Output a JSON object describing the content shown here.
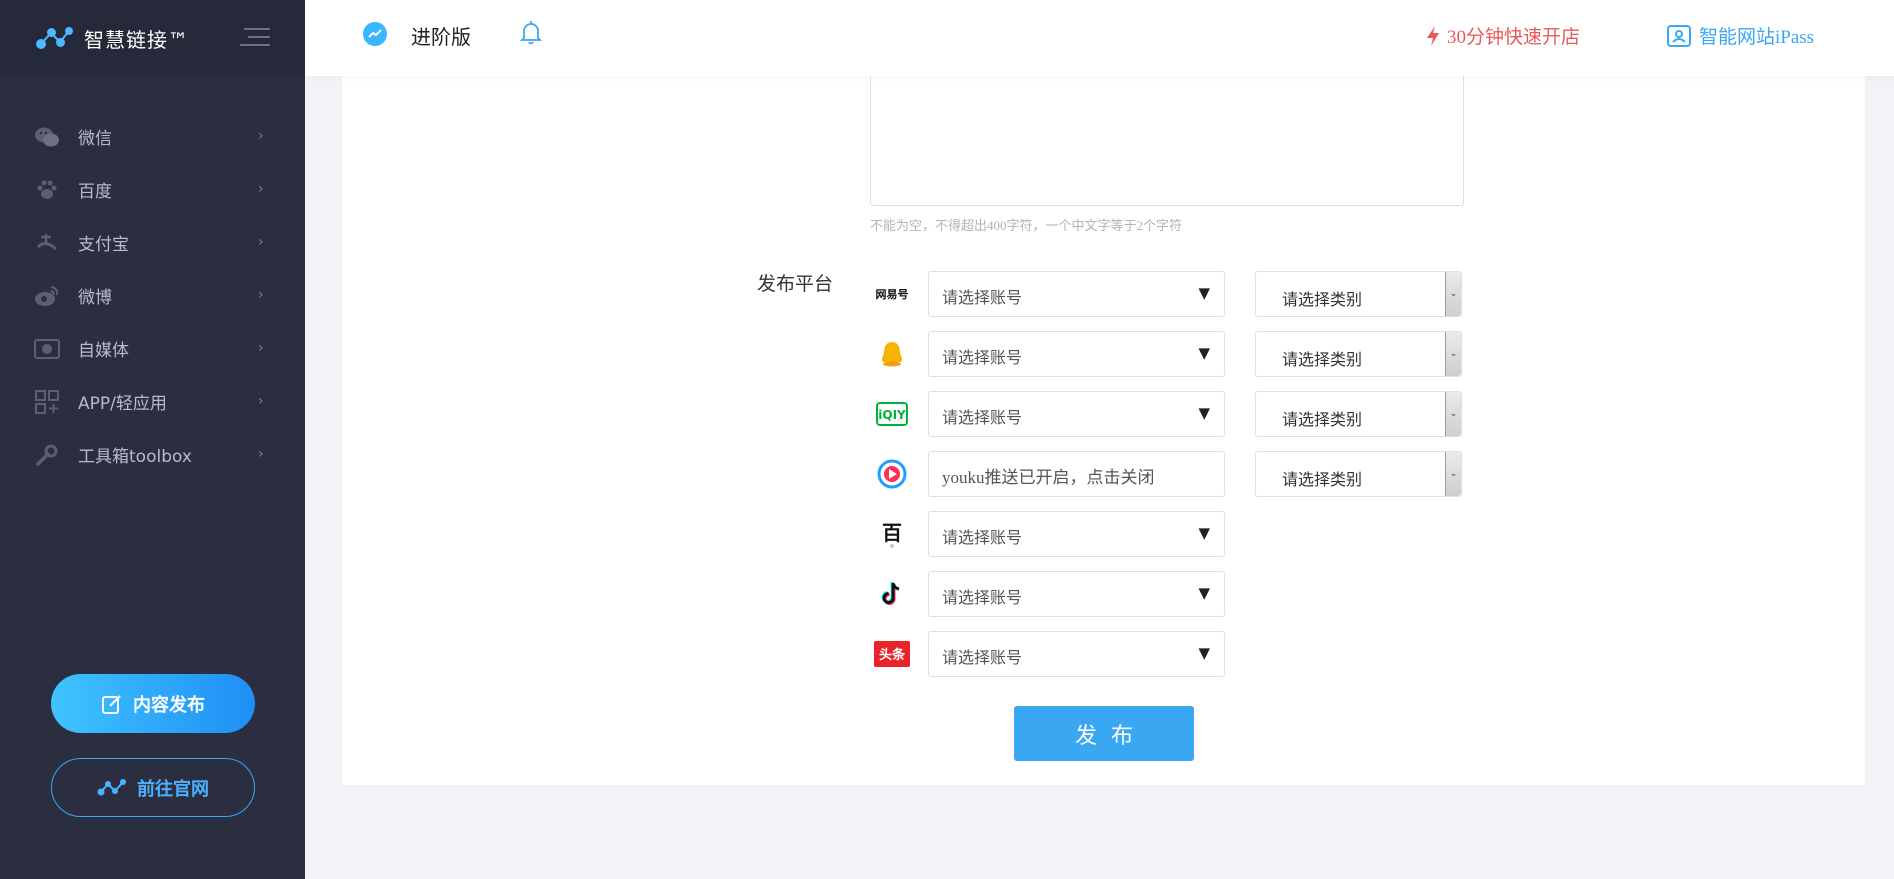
{
  "app": {
    "logo_text": "智慧链接™"
  },
  "sidebar": {
    "items": [
      {
        "label": "微信",
        "icon": "wechat-icon"
      },
      {
        "label": "百度",
        "icon": "paw-icon"
      },
      {
        "label": "支付宝",
        "icon": "alipay-icon"
      },
      {
        "label": "微博",
        "icon": "weibo-icon"
      },
      {
        "label": "自媒体",
        "icon": "media-icon"
      },
      {
        "label": "APP/轻应用",
        "icon": "apps-grid-icon"
      },
      {
        "label": "工具箱toolbox",
        "icon": "wrench-icon"
      }
    ],
    "publish_button": "内容发布",
    "site_button": "前往官网"
  },
  "header": {
    "version_label": "进阶版",
    "quick_open": "30分钟快速开店",
    "ipass": "智能网站iPass"
  },
  "form": {
    "hint": "不能为空，不得超出400字符，一个中文字等于2个字符",
    "platform_label": "发布平台",
    "rows": [
      {
        "platform": "网易号",
        "icon": "netease-icon",
        "account": "请选择账号",
        "category": "请选择类别"
      },
      {
        "platform": "QQ",
        "icon": "qq-penguin-icon",
        "account": "请选择账号",
        "category": "请选择类别"
      },
      {
        "platform": "iQIYI",
        "icon": "iqiyi-icon",
        "account": "请选择账号",
        "category": "请选择类别"
      },
      {
        "platform": "youku",
        "icon": "youku-icon",
        "account": "youku推送已开启，点击关闭",
        "category": "请选择类别"
      },
      {
        "platform": "百家号",
        "icon": "baijiahao-icon",
        "account": "请选择账号"
      },
      {
        "platform": "抖音",
        "icon": "douyin-icon",
        "account": "请选择账号"
      },
      {
        "platform": "头条",
        "icon": "toutiao-icon",
        "account": "请选择账号"
      }
    ],
    "submit": "发布"
  },
  "colors": {
    "sidebar_bg": "#2b2e40",
    "accent": "#3aa7f3",
    "promo_red": "#e85a5a"
  }
}
